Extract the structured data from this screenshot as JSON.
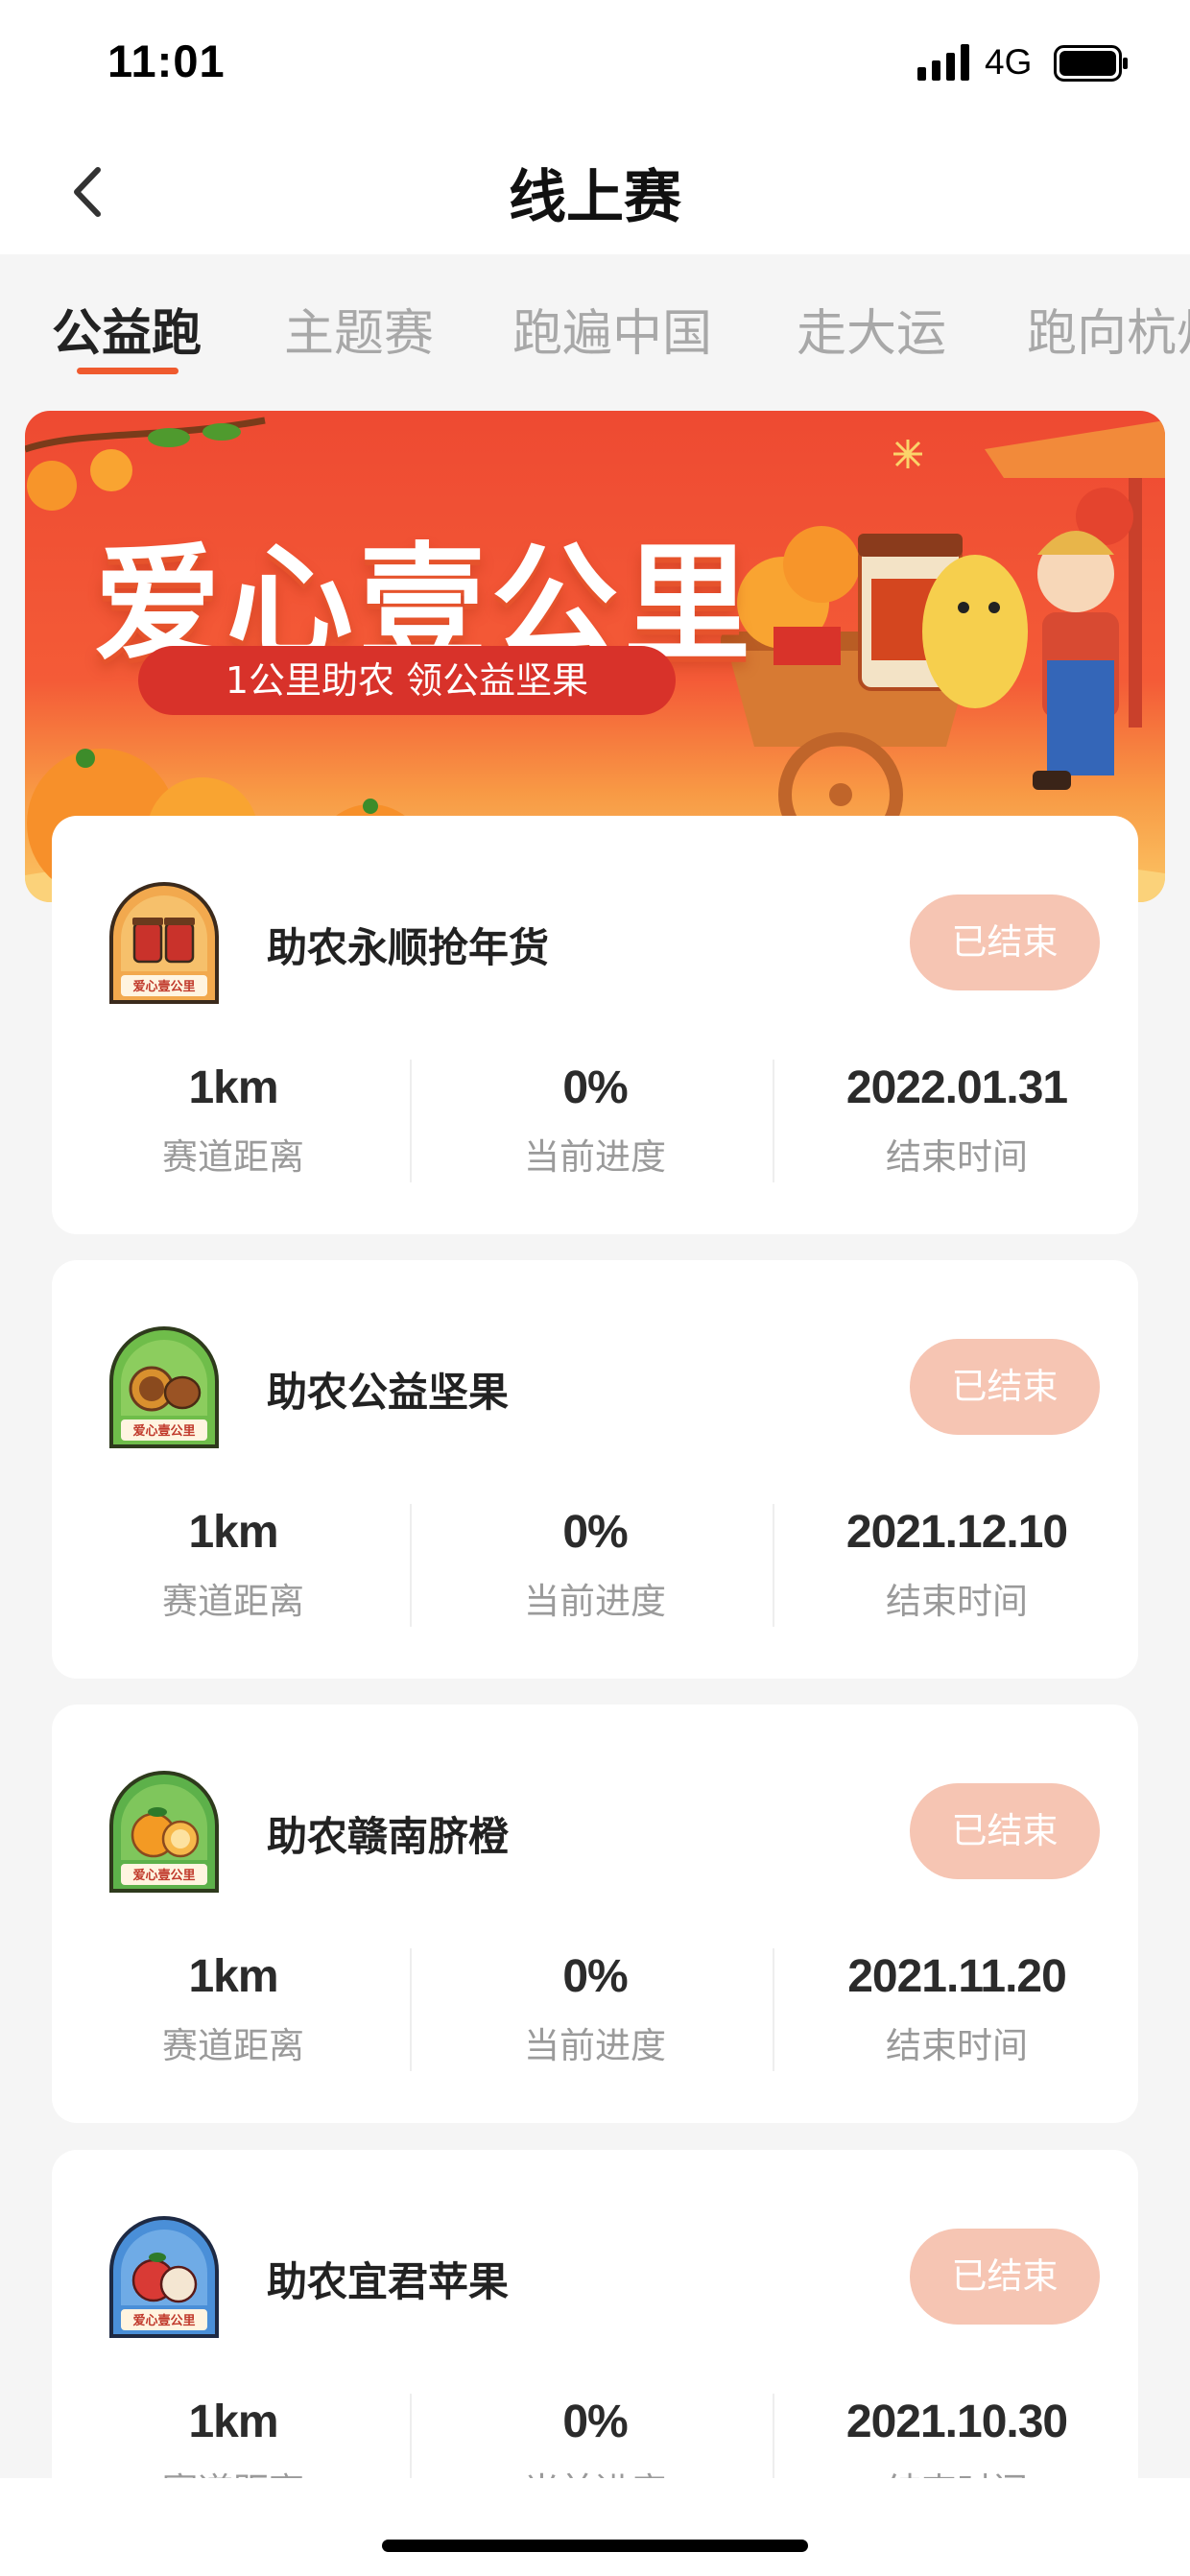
{
  "status_bar": {
    "time": "11:01",
    "network": "4G"
  },
  "nav": {
    "title": "线上赛"
  },
  "tabs": [
    {
      "label": "公益跑",
      "active": true
    },
    {
      "label": "主题赛",
      "active": false
    },
    {
      "label": "跑遍中国",
      "active": false
    },
    {
      "label": "走大运",
      "active": false
    },
    {
      "label": "跑向杭州",
      "active": false
    }
  ],
  "banner": {
    "title": "爱心壹公里",
    "subtitle": "1公里助农  领公益坚果"
  },
  "colors": {
    "accent": "#ef5a2e",
    "ended_button": "#f6c5b3"
  },
  "events": [
    {
      "title": "助农永顺抢年货",
      "status": "已结束",
      "distance": "1km",
      "distance_label": "赛道距离",
      "progress": "0%",
      "progress_label": "当前进度",
      "end_time": "2022.01.31",
      "end_time_label": "结束时间",
      "badge_icon": "jam-jar-icon"
    },
    {
      "title": "助农公益坚果",
      "status": "已结束",
      "distance": "1km",
      "distance_label": "赛道距离",
      "progress": "0%",
      "progress_label": "当前进度",
      "end_time": "2021.12.10",
      "end_time_label": "结束时间",
      "badge_icon": "chestnut-icon"
    },
    {
      "title": "助农赣南脐橙",
      "status": "已结束",
      "distance": "1km",
      "distance_label": "赛道距离",
      "progress": "0%",
      "progress_label": "当前进度",
      "end_time": "2021.11.20",
      "end_time_label": "结束时间",
      "badge_icon": "orange-icon"
    },
    {
      "title": "助农宜君苹果",
      "status": "已结束",
      "distance": "1km",
      "distance_label": "赛道距离",
      "progress": "0%",
      "progress_label": "当前进度",
      "end_time": "2021.10.30",
      "end_time_label": "结束时间",
      "badge_icon": "apple-icon"
    }
  ]
}
